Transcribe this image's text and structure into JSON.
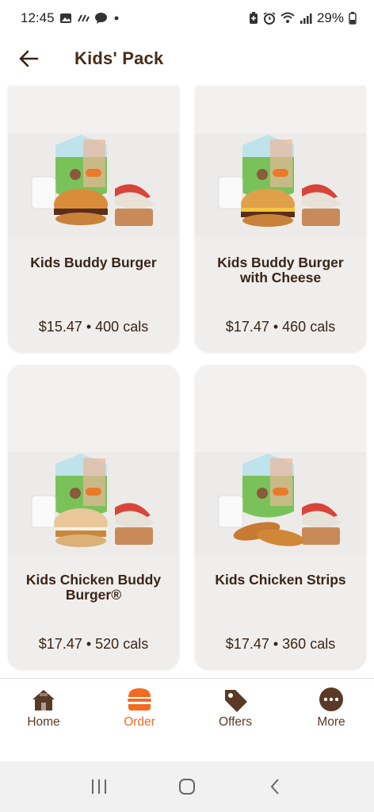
{
  "status_bar": {
    "time": "12:45",
    "battery": "29%",
    "left_icons": [
      "image-icon",
      "signal-dots-icon",
      "chat-icon",
      "dot-icon"
    ],
    "right_icons": [
      "battery-saver-icon",
      "alarm-icon",
      "wifi-icon",
      "cell-signal-icon",
      "battery-icon"
    ]
  },
  "header": {
    "title": "Kids' Pack",
    "back_icon": "arrow-left-icon"
  },
  "products": [
    {
      "name": "Kids Buddy Burger",
      "price_line": "$15.47 • 400 cals",
      "image": "buddy-burger-meal"
    },
    {
      "name": "Kids Buddy Burger with Cheese",
      "price_line": "$17.47 • 460 cals",
      "image": "cheese-burger-meal"
    },
    {
      "name": "Kids Chicken Buddy Burger®",
      "price_line": "$17.47 • 520 cals",
      "image": "chicken-burger-meal"
    },
    {
      "name": "Kids Chicken Strips",
      "price_line": "$17.47 • 360 cals",
      "image": "chicken-strips-meal"
    }
  ],
  "bottom_nav": [
    {
      "label": "Home",
      "icon": "home-icon",
      "active": false
    },
    {
      "label": "Order",
      "icon": "burger-icon",
      "active": true
    },
    {
      "label": "Offers",
      "icon": "tag-icon",
      "active": false
    },
    {
      "label": "More",
      "icon": "more-icon",
      "active": false
    }
  ],
  "colors": {
    "accent": "#f26b21",
    "brown": "#4a2c1a",
    "card_bg": "#efeeed"
  }
}
